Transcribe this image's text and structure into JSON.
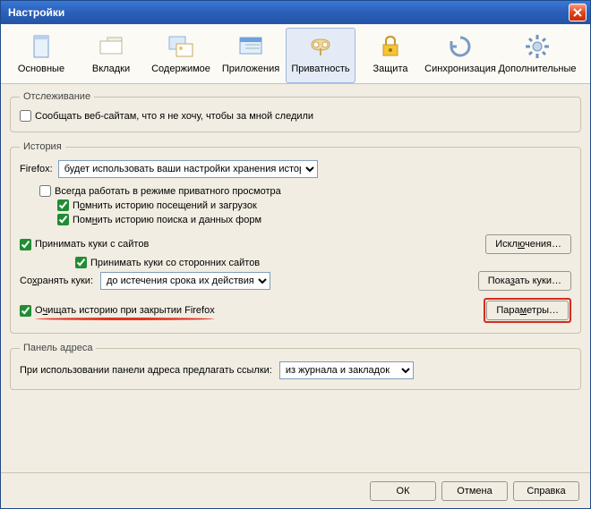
{
  "titlebar": {
    "title": "Настройки"
  },
  "toolbar": {
    "items": [
      {
        "id": "general",
        "label": "Основные"
      },
      {
        "id": "tabs",
        "label": "Вкладки"
      },
      {
        "id": "content",
        "label": "Содержимое"
      },
      {
        "id": "apps",
        "label": "Приложения"
      },
      {
        "id": "privacy",
        "label": "Приватность",
        "active": true
      },
      {
        "id": "security",
        "label": "Защита"
      },
      {
        "id": "sync",
        "label": "Синхронизация"
      },
      {
        "id": "advanced",
        "label": "Дополнительные"
      }
    ]
  },
  "tracking": {
    "legend": "Отслеживание",
    "dnt_label": "Сообщать веб-сайтам, что я не хочу, чтобы за мной следили",
    "dnt_checked": false
  },
  "history": {
    "legend": "История",
    "firefox_label": "Firefox:",
    "mode_selected": "будет использовать ваши настройки хранения истории",
    "always_private": {
      "label": "Всегда работать в режиме приватного просмотра",
      "checked": false
    },
    "remember_visits": {
      "label": "Помнить историю посещений и загрузок",
      "checked": true
    },
    "remember_search": {
      "label": "Помнить историю поиска и данных форм",
      "checked": true
    },
    "accept_cookies": {
      "label": "Принимать куки с сайтов",
      "checked": true
    },
    "exceptions_btn": "Исключения…",
    "third_party": {
      "label": "Принимать куки со сторонних сайтов",
      "checked": true
    },
    "keep_cookies_label": "Сохранять куки:",
    "keep_cookies_selected": "до истечения срока их действия",
    "show_cookies_btn": "Показать куки…",
    "clear_on_close": {
      "label": "Очищать историю при закрытии Firefox",
      "checked": true
    },
    "parameters_btn": "Параметры…"
  },
  "addressbar": {
    "legend": "Панель адреса",
    "suggest_label": "При использовании панели адреса предлагать ссылки:",
    "suggest_selected": "из журнала и закладок"
  },
  "footer": {
    "ok": "ОК",
    "cancel": "Отмена",
    "help": "Справка"
  }
}
